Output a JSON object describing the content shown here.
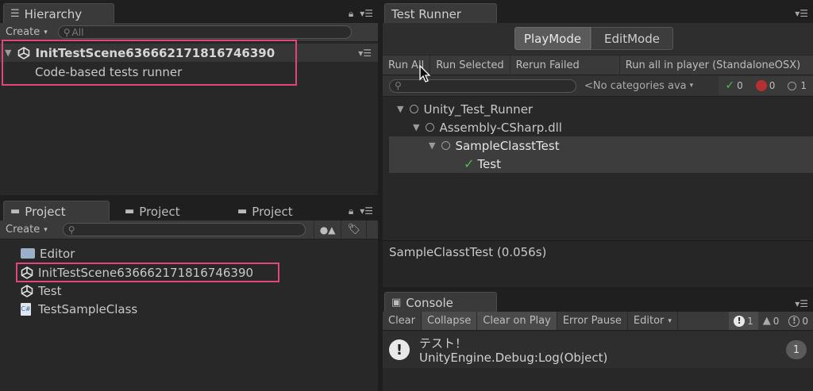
{
  "hierarchy": {
    "tab_title": "Hierarchy",
    "create_label": "Create",
    "search_placeholder": "All",
    "scene_name": "InitTestScene636662171816746390",
    "child_item": "Code-based tests runner"
  },
  "project": {
    "tabs": [
      {
        "label": "Project"
      },
      {
        "label": "Project"
      },
      {
        "label": "Project"
      }
    ],
    "create_label": "Create",
    "items": [
      {
        "label": "Editor",
        "icon": "folder-icon"
      },
      {
        "label": "InitTestScene636662171816746390",
        "icon": "unity-scene-icon"
      },
      {
        "label": "Test",
        "icon": "unity-scene-icon"
      },
      {
        "label": "TestSampleClass",
        "icon": "csharp-script-icon"
      }
    ]
  },
  "test_runner": {
    "tab_title": "Test Runner",
    "mode_play": "PlayMode",
    "mode_edit": "EditMode",
    "buttons": {
      "run_all": "Run All",
      "run_selected": "Run Selected",
      "rerun_failed": "Rerun Failed",
      "run_in_player": "Run all in player (StandaloneOSX)"
    },
    "categories_label": "<No categories ava",
    "counts": {
      "passed": "0",
      "failed": "0",
      "ignored": "1"
    },
    "tree": [
      {
        "label": "Unity_Test_Runner",
        "level": 0,
        "status": "circle"
      },
      {
        "label": "Assembly-CSharp.dll",
        "level": 1,
        "status": "circle"
      },
      {
        "label": "SampleClasstTest",
        "level": 2,
        "status": "circle"
      },
      {
        "label": "Test",
        "level": 3,
        "status": "check"
      }
    ],
    "result_text": "SampleClasstTest (0.056s)"
  },
  "console": {
    "tab_title": "Console",
    "buttons": {
      "clear": "Clear",
      "collapse": "Collapse",
      "clear_on_play": "Clear on Play",
      "error_pause": "Error Pause",
      "editor": "Editor"
    },
    "counts": {
      "info": "1",
      "warning": "0",
      "error": "0"
    },
    "entry": {
      "line1": "テスト！",
      "line2": "UnityEngine.Debug:Log(Object)",
      "count": "1"
    }
  },
  "colors": {
    "accent_highlight": "#e0457b",
    "pass_green": "#4cc04c",
    "selected_row": "#3d3d3d"
  }
}
